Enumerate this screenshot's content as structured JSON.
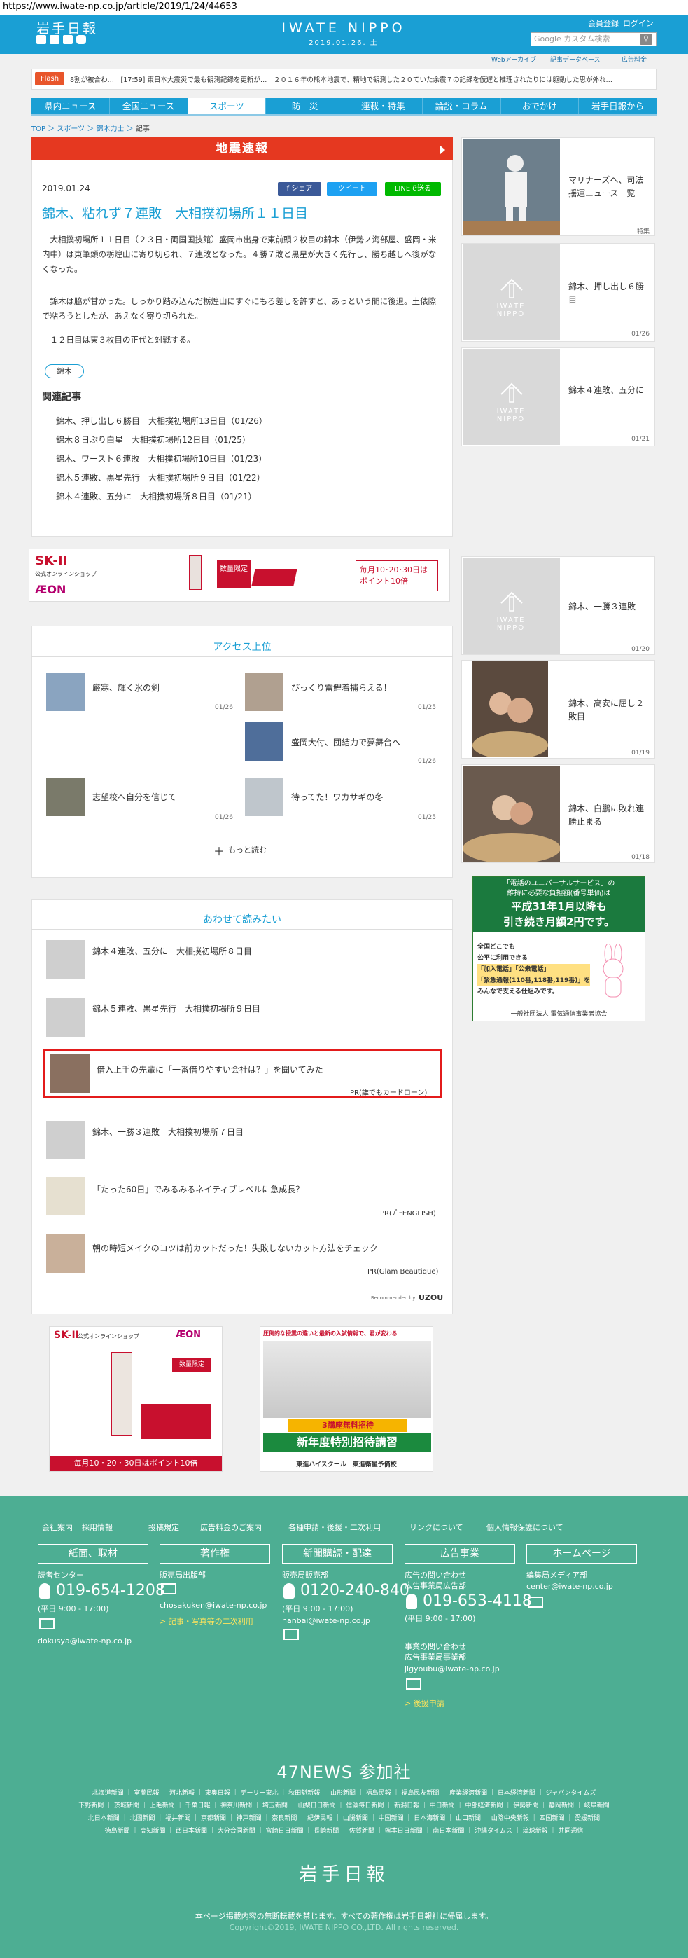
{
  "browser": {
    "url": "https://www.iwate-np.co.jp/article/2019/1/24/44653"
  },
  "header": {
    "logo": "岩手日報",
    "brand": "IWATE NIPPO",
    "date": "2019.01.26. 土",
    "member_register": "会員登録",
    "login": "ログイン",
    "search_placeholder": "Google カスタム検索",
    "sub_links": [
      "Webアーカイブ",
      "記事データベース",
      "広告料金"
    ]
  },
  "flash": {
    "badge": "Flash",
    "text": "8割が被合わ…　[17:59] 東日本大震災で最も観測記録を更新が…　２０１６年の熊本地震で、精地で観測した２０ていた余震７の記録を仮遅と推理されたりには躯動した思が外れ…"
  },
  "nav": [
    "県内ニュース",
    "全国ニュース",
    "スポーツ",
    "防　災",
    "連載・特集",
    "論説・コラム",
    "おでかけ",
    "岩手日報から"
  ],
  "breadcrumb": {
    "top": "TOP",
    "sports": "スポーツ",
    "sumo": "錦木力士",
    "current": "記事"
  },
  "alert": {
    "label": "地震速報"
  },
  "article": {
    "date": "2019.01.24",
    "share": {
      "facebook": "f シェア",
      "twitter": "ツイート",
      "line": "LINEで送る"
    },
    "title": "錦木、粘れず７連敗　大相撲初場所１１日目",
    "paragraphs": [
      "大相撲初場所１１日目（２３日・両国国技館）盛岡市出身で東前頭２枚目の錦木（伊勢ノ海部屋、盛岡・米内中）は東筆頭の栃煌山に寄り切られ、７連敗となった。４勝７敗と黒星が大きく先行し、勝ち越しへ後がなくなった。",
      "錦木は脇が甘かった。しっかり踏み込んだ栃煌山にすぐにもろ差しを許すと、あっという間に後退。土俵際で粘ろうとしたが、あえなく寄り切られた。",
      "１２日目は東３枚目の正代と対戦する。"
    ],
    "tag": "錦木",
    "related_heading": "関連記事",
    "related": [
      "錦木、押し出し６勝目　大相撲初場所13日目（01/26）",
      "錦木８日ぶり白星　大相撲初場所12日目（01/25）",
      "錦木、ワースト６連敗　大相撲初場所10日目（01/23）",
      "錦木５連敗、黒星先行　大相撲初場所９日目（01/22）",
      "錦木４連敗、五分に　大相撲初場所８日目（01/21）"
    ]
  },
  "sidebar": [
    {
      "title": "マリナーズへ、司法揺運ニュース一覧",
      "date": "特集"
    },
    {
      "title": "錦木、押し出し６勝目",
      "date": "01/26"
    },
    {
      "title": "錦木４連敗、五分に",
      "date": "01/21"
    },
    {
      "title": "錦木、一勝３連敗",
      "date": "01/20"
    },
    {
      "title": "錦木、高安に屈し２敗目",
      "date": "01/19"
    },
    {
      "title": "錦木、白鵬に敗れ連勝止まる",
      "date": "01/18"
    }
  ],
  "side_logo": "IWATE NIPPO",
  "ad_banner": {
    "brand": "SK-II",
    "shop": "公式オンラインショップ",
    "aeon": "ÆON",
    "limited": "数量限定",
    "promo": "毎月10･20･30日は ポイント10倍"
  },
  "access": {
    "heading": "アクセス上位",
    "items": [
      {
        "title": "厳寒、輝く氷の剣",
        "date": "01/26"
      },
      {
        "title": "びっくり雷鯉着捕らえる！",
        "date": "01/25"
      },
      {
        "title": "盛岡大付、団結力で夢舞台へ",
        "date": "01/26"
      },
      {
        "title": "志望校へ自分を信じて",
        "date": "01/26"
      },
      {
        "title": "待ってた！ワカサギの冬",
        "date": "01/25"
      }
    ],
    "more": "もっと読む"
  },
  "recommend": {
    "heading": "あわせて読みたい",
    "items": [
      {
        "title": "錦木４連敗、五分に　大相撲初場所８日目",
        "pr": ""
      },
      {
        "title": "錦木５連敗、黒星先行　大相撲初場所９日目",
        "pr": ""
      },
      {
        "title": "借入上手の先輩に「一番借りやすい会社は？」を聞いてみた",
        "pr": "PR(誰でもカードローン)"
      },
      {
        "title": "錦木、一勝３連敗　大相撲初場所７日目",
        "pr": ""
      },
      {
        "title": "「たった60日」でみるみるネイティブレベルに急成長？",
        "pr": "PR(ﾌﾟｰENGLISH)"
      },
      {
        "title": "朝の時短メイクのコツは前カットだった！失敗しないカット方法をチェック",
        "pr": "PR(Glam Beautique)"
      }
    ],
    "credit": "Recommended by",
    "credit_brand": "UZOU"
  },
  "side_ad": {
    "l1": "「電話のユニバーサルサービス」の",
    "l2": "維持に必要な負担額(番号単価)は",
    "l3": "平成31年1月以降も",
    "l4": "引き続き月額2円です。",
    "l5": "全国どこでも",
    "l6": "公平に利用できる",
    "l7": "「加入電話」「公衆電話」",
    "l8": "「緊急通報(110番,118番,119番)」を",
    "l9": "みんなで支える仕組みです。",
    "l10": "一般社団法人 電気通信事業者協会"
  },
  "ad_bottom": {
    "left_promo": "毎月10・20・30日はポイント10倍",
    "right_top": "圧倒的な授業の違いと最新の入試情報で、君が変わる",
    "right_free": "3講座無料招待",
    "right_main": "新年度特別招待講習",
    "right_school": "東進ハイスクール　東進衛星予備校"
  },
  "footer": {
    "links": [
      "会社案内",
      "採用情報",
      "投稿規定",
      "広告料金のご案内",
      "各種申請・後援・二次利用",
      "リンクについて",
      "個人情報保護について"
    ],
    "boxes": [
      "紙面、取材",
      "著作権",
      "新聞購読・配達",
      "広告事業",
      "ホームページ"
    ],
    "col1": {
      "label": "読者センター",
      "phone": "019-654-1208",
      "hours": "(平日 9:00 - 17:00)",
      "email": "dokusya@iwate-np.co.jp"
    },
    "col2": {
      "label": "販売局出版部",
      "email": "chosakuken@iwate-np.co.jp",
      "link": "> 記事・写真等の二次利用"
    },
    "col3": {
      "label": "販売局販売部",
      "phone": "0120-240-840",
      "hours": "(平日 9:00 - 17:00)",
      "email": "hanbai@iwate-np.co.jp"
    },
    "col4": {
      "label1": "広告の問い合わせ",
      "label2": "広告事業局広告部",
      "phone": "019-653-4118",
      "hours": "(平日 9:00 - 17:00)",
      "label3": "事業の問い合わせ",
      "label4": "広告事業局事業部",
      "email": "jigyoubu@iwate-np.co.jp",
      "link": "> 後援申請"
    },
    "col5": {
      "label": "編集局メディア部",
      "email": "center@iwate-np.co.jp"
    },
    "news47": "47NEWS 参加社",
    "papers1": "北海道新聞 ｜ 室蘭民報 ｜ 河北新報 ｜ 東奥日報 ｜ デーリー東北 ｜ 秋田魁新報 ｜ 山形新聞 ｜ 福島民報 ｜ 福島民友新聞 ｜ 産業経済新聞 ｜ 日本経済新聞 ｜ ジャパンタイムズ",
    "papers2": "下野新聞 ｜ 茨城新聞 ｜ 上毛新聞 ｜ 千葉日報 ｜ 神奈川新聞 ｜ 埼玉新聞 ｜ 山梨日日新聞 ｜ 信濃毎日新聞 ｜ 新潟日報 ｜ 中日新聞 ｜ 中部経済新聞 ｜ 伊勢新聞 ｜ 静岡新聞 ｜ 岐阜新聞",
    "papers3": "北日本新聞 ｜ 北國新聞 ｜ 福井新聞 ｜ 京都新聞 ｜ 神戸新聞 ｜ 奈良新聞 ｜ 紀伊民報 ｜ 山陽新聞 ｜ 中国新聞 ｜ 日本海新聞 ｜ 山口新聞 ｜ 山陰中央新報 ｜ 四国新聞 ｜ 愛媛新聞",
    "papers4": "徳島新聞 ｜ 高知新聞 ｜ 西日本新聞 ｜ 大分合同新聞 ｜ 宮崎日日新聞 ｜ 長崎新聞 ｜ 佐賀新聞 ｜ 熊本日日新聞 ｜ 南日本新聞 ｜ 沖縄タイムス ｜ 琉球新報 ｜ 共同通信",
    "logo": "岩手日報",
    "notice": "本ページ掲載内容の無断転載を禁じます。すべての著作権は岩手日報社に帰属します。",
    "copyright": "Copyright©2019, IWATE NIPPO CO.,LTD. All rights reserved."
  }
}
